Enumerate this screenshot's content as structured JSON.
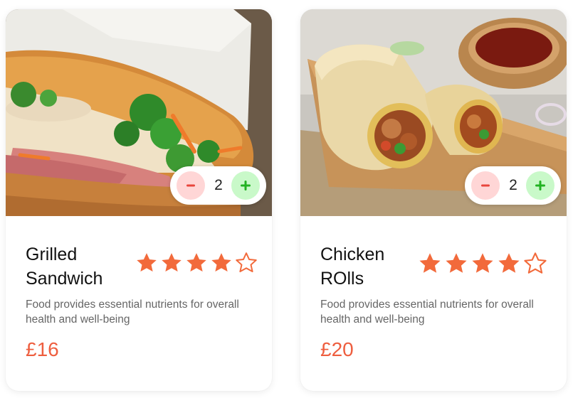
{
  "cards": [
    {
      "title": "Grilled Sandwich",
      "image": "grilled-sandwich-photo",
      "quantity": "2",
      "rating": 4,
      "rating_max": 5,
      "description": "Food provides essential nutrients for overall health and well-being",
      "price": "£16"
    },
    {
      "title": "Chicken ROlls",
      "image": "chicken-rolls-photo",
      "quantity": "2",
      "rating": 4,
      "rating_max": 5,
      "description": "Food provides essential nutrients for overall health and well-being",
      "price": "£20"
    }
  ],
  "colors": {
    "accent": "#ee5e3f",
    "star": "#f26a3b",
    "minus_bg": "#ffd6d6",
    "minus_icon": "#e8453c",
    "plus_bg": "#c9f9c9",
    "plus_icon": "#22b222"
  },
  "icons": {
    "minus": "minus-icon",
    "plus": "plus-icon",
    "star_filled": "star-filled-icon",
    "star_empty": "star-outline-icon"
  }
}
